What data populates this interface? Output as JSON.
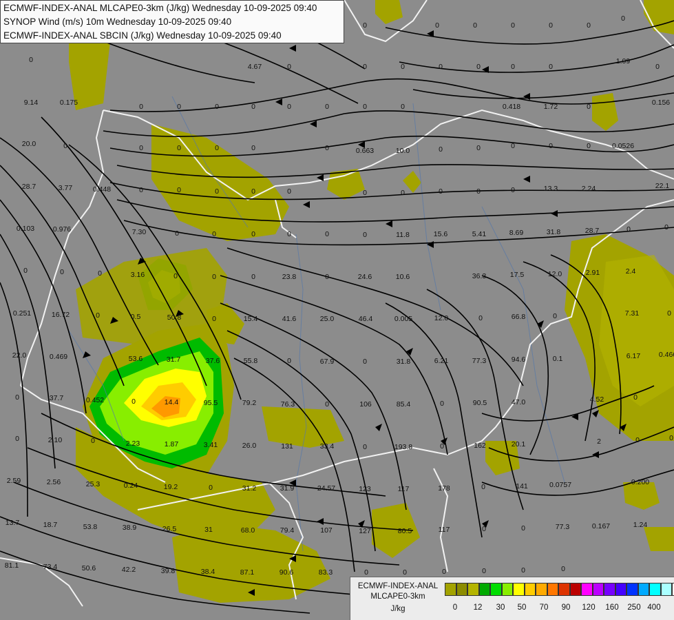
{
  "header": {
    "line1": "ECMWF-INDEX-ANAL MLCAPE0-3km (J/kg) Wednesday 10-09-2025 09:40",
    "line2": "SYNOP Wind (m/s) 10m Wednesday 10-09-2025 09:40",
    "line3": "ECMWF-INDEX-ANAL SBCIN (J/kg) Wednesday 10-09-2025 09:40"
  },
  "legend": {
    "title_line1": "ECMWF-INDEX-ANAL",
    "title_line2": "MLCAPE0-3km",
    "unit": "J/kg",
    "colors": [
      "#a3a300",
      "#8c8c00",
      "#b4b400",
      "#00aa00",
      "#00dd00",
      "#88ee00",
      "#ffff00",
      "#ffcc00",
      "#ffaa00",
      "#ff7700",
      "#dd3300",
      "#bb0000",
      "#ff00ff",
      "#bb00ff",
      "#7700ff",
      "#4400ff",
      "#0033ff",
      "#00aaff",
      "#00ffff",
      "#aaffff",
      "#ffffff"
    ],
    "ticks": [
      "0",
      "12",
      "30",
      "50",
      "70",
      "90",
      "120",
      "160",
      "250",
      "400"
    ]
  },
  "map_values": [
    "0",
    "0",
    "0",
    "0",
    "0",
    "0",
    "0",
    "0",
    "0",
    "0",
    "0",
    "0",
    "0",
    "4.67",
    "0",
    "0",
    "0",
    "0",
    "0",
    "0",
    "0",
    "1.09",
    "0",
    "9.14",
    "0.175",
    "0",
    "0",
    "0",
    "0",
    "0",
    "0",
    "0",
    "0",
    "0.418",
    "1.72",
    "0",
    "0.156",
    "20.0",
    "0",
    "0",
    "0",
    "0",
    "0",
    "0",
    "0.663",
    "10.0",
    "0",
    "0",
    "0",
    "0",
    "0",
    "0.0526",
    "28.7",
    "3.77",
    "0.448",
    "0",
    "0",
    "0",
    "0",
    "0",
    "0",
    "0",
    "0",
    "0",
    "0",
    "13.3",
    "2.24",
    "22.1",
    "0.103",
    "0.976",
    "7.30",
    "0",
    "0",
    "0",
    "0",
    "0",
    "0",
    "11.8",
    "15.6",
    "5.41",
    "8.69",
    "31.8",
    "28.7",
    "0",
    "0",
    "0",
    "0",
    "0",
    "3.16",
    "0",
    "0",
    "0",
    "23.8",
    "0",
    "24.6",
    "10.6",
    "36.3",
    "17.5",
    "12.0",
    "2.91",
    "2.4",
    "0.251",
    "16.72",
    "0",
    "0.5",
    "50.8",
    "0",
    "15.4",
    "41.6",
    "25.0",
    "46.4",
    "0.005",
    "12.0",
    "0",
    "66.8",
    "0",
    "7.31",
    "0",
    "22.0",
    "0.469",
    "53.6",
    "31.7",
    "37.6",
    "55.8",
    "0",
    "67.9",
    "0",
    "31.8",
    "6.21",
    "77.3",
    "94.6",
    "0.1",
    "6.17",
    "0.466",
    "0",
    "37.7",
    "0.452",
    "0",
    "14.4",
    "95.5",
    "79.2",
    "76.3",
    "0",
    "106",
    "85.4",
    "0",
    "90.5",
    "47.0",
    "4.52",
    "0",
    "0",
    "2.10",
    "0",
    "2.23",
    "1.87",
    "3.41",
    "26.0",
    "131",
    "33.4",
    "0",
    "193.8",
    "0",
    "162",
    "20.1",
    "2",
    "0",
    "0",
    "2.59",
    "2.56",
    "25.3",
    "0.24",
    "19.2",
    "0",
    "31.2",
    "31.9",
    "24.57",
    "123",
    "117",
    "178",
    "0",
    "141",
    "0.0757",
    "0.200",
    "13.7",
    "18.7",
    "53.8",
    "38.9",
    "26.5",
    "31",
    "68.0",
    "79.4",
    "107",
    "127",
    "80.5",
    "117",
    "0",
    "0",
    "77.3",
    "0.167",
    "1.24",
    "81.1",
    "73.4",
    "50.6",
    "42.2",
    "39.8",
    "38.4",
    "87.1",
    "90.6",
    "83.3",
    "0",
    "0",
    "0",
    "0",
    "0",
    "0"
  ]
}
